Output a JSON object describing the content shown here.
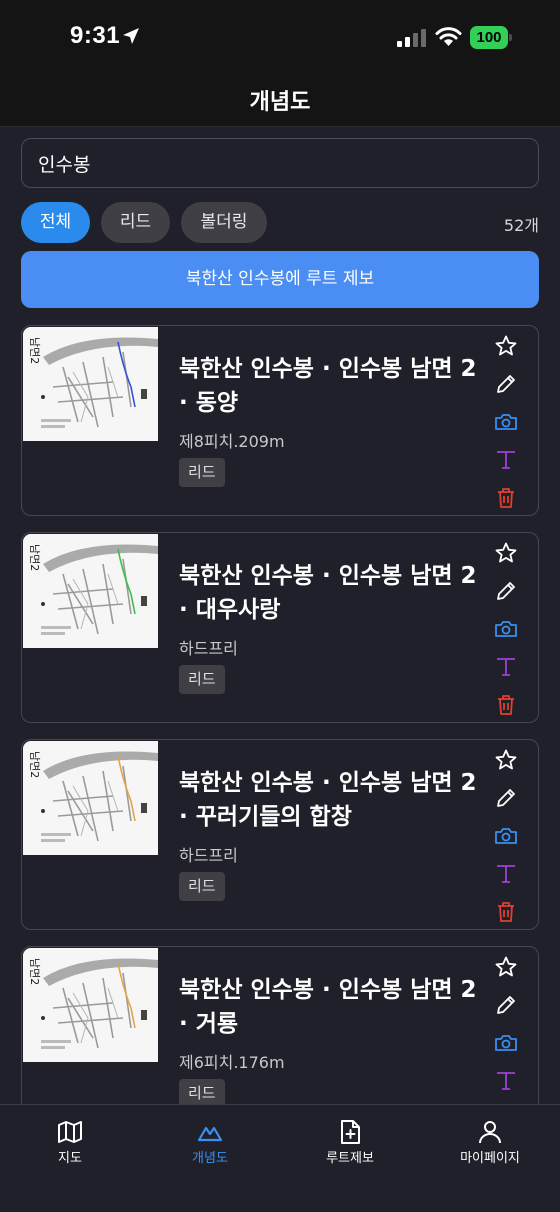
{
  "status_bar": {
    "time": "9:31",
    "battery": "100"
  },
  "header": {
    "title": "개념도"
  },
  "search": {
    "value": "인수봉",
    "placeholder": ""
  },
  "filters": {
    "chips": [
      {
        "label": "전체",
        "active": true
      },
      {
        "label": "리드",
        "active": false
      },
      {
        "label": "볼더링",
        "active": false
      }
    ],
    "count": "52개"
  },
  "report_button": {
    "label": "북한산 인수봉에 루트 제보"
  },
  "routes": [
    {
      "title": "북한산 인수봉 · 인수봉 남면 2 · 동양",
      "subtitle": "제8피치.209m",
      "type": "리드",
      "line_color": "#3a4fd8"
    },
    {
      "title": "북한산 인수봉 · 인수봉 남면 2 · 대우사랑",
      "subtitle": "하드프리",
      "type": "리드",
      "line_color": "#3bbf4a"
    },
    {
      "title": "북한산 인수봉 · 인수봉 남면 2 · 꾸러기들의 합창",
      "subtitle": "하드프리",
      "type": "리드",
      "line_color": "#e8a24a"
    },
    {
      "title": "북한산 인수봉 · 인수봉 남면 2 · 거룡",
      "subtitle": "제6피치.176m",
      "type": "리드",
      "line_color": "#e8a24a"
    }
  ],
  "card_actions": [
    "star-icon",
    "pencil-icon",
    "camera-icon",
    "text-icon",
    "trash-icon"
  ],
  "colors": {
    "accent": "#3a8ff0",
    "camera": "#3a8ff0",
    "text_icon": "#a040d8",
    "trash": "#e0402f"
  },
  "tab_bar": {
    "tabs": [
      {
        "label": "지도",
        "icon": "map-icon",
        "active": false
      },
      {
        "label": "개념도",
        "icon": "mountain-icon",
        "active": true
      },
      {
        "label": "루트제보",
        "icon": "file-plus-icon",
        "active": false
      },
      {
        "label": "마이페이지",
        "icon": "user-icon",
        "active": false
      }
    ]
  }
}
